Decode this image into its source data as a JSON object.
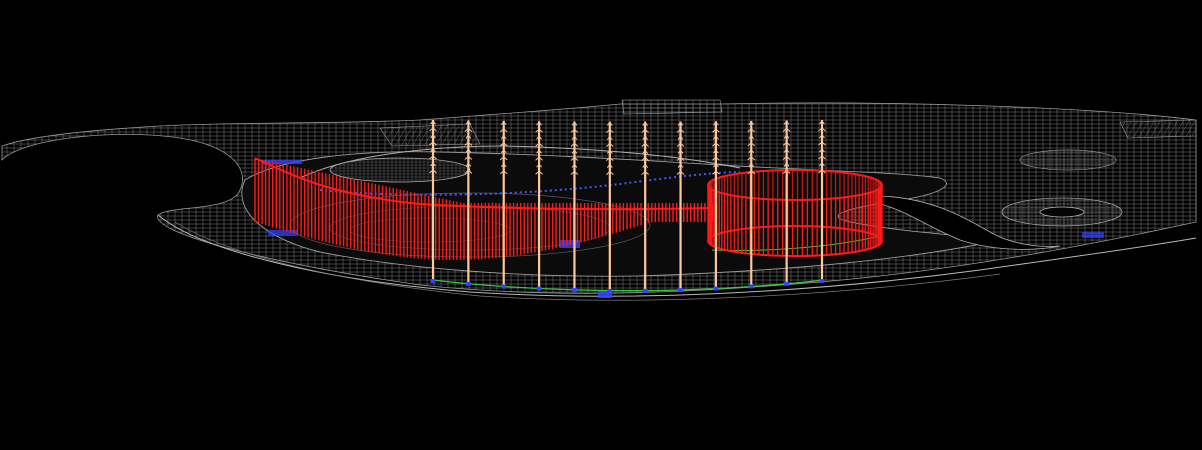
{
  "view": {
    "background_color": "#000000",
    "plan_linework_color": "#8a8a8a",
    "plan_detail_color": "#6e6e6e",
    "edge_line_color": "#33cc33",
    "marker_color": "#3344ff",
    "curtain_color": "#ff1a1a",
    "jet_color": "#ffc89a"
  },
  "scene": {
    "fountain_jets": {
      "count": 12
    },
    "water_curtain_large": {
      "strands": 130
    },
    "water_curtain_ring": {
      "strands": 110
    }
  }
}
